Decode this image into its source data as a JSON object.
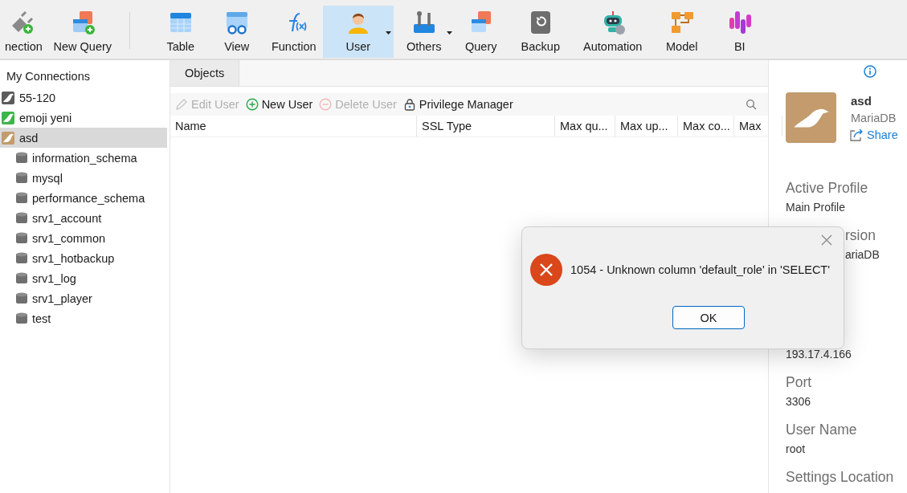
{
  "toolbar": {
    "items": [
      {
        "label": "nection",
        "selected": false,
        "dropdown": false
      },
      {
        "label": "New Query",
        "selected": false,
        "dropdown": false
      },
      {
        "label": "Table",
        "selected": false,
        "dropdown": false
      },
      {
        "label": "View",
        "selected": false,
        "dropdown": false
      },
      {
        "label": "Function",
        "selected": false,
        "dropdown": false
      },
      {
        "label": "User",
        "selected": true,
        "dropdown": true
      },
      {
        "label": "Others",
        "selected": false,
        "dropdown": true
      },
      {
        "label": "Query",
        "selected": false,
        "dropdown": false
      },
      {
        "label": "Backup",
        "selected": false,
        "dropdown": false
      },
      {
        "label": "Automation",
        "selected": false,
        "dropdown": false
      },
      {
        "label": "Model",
        "selected": false,
        "dropdown": false
      },
      {
        "label": "BI",
        "selected": false,
        "dropdown": false
      }
    ]
  },
  "sidebar": {
    "title": "My Connections",
    "connections": [
      {
        "name": "55-120",
        "selected": false,
        "color": "#5b5b5b"
      },
      {
        "name": "emoji yeni",
        "selected": false,
        "color": "#3db54a"
      },
      {
        "name": "asd",
        "selected": true,
        "color": "#c39b6c",
        "children": [
          {
            "name": "information_schema"
          },
          {
            "name": "mysql"
          },
          {
            "name": "performance_schema"
          },
          {
            "name": "srv1_account"
          },
          {
            "name": "srv1_common"
          },
          {
            "name": "srv1_hotbackup"
          },
          {
            "name": "srv1_log"
          },
          {
            "name": "srv1_player"
          },
          {
            "name": "test"
          }
        ]
      }
    ]
  },
  "tabs": [
    {
      "label": "Objects",
      "selected": true
    }
  ],
  "actions": [
    {
      "label": "Edit User",
      "disabled": true,
      "kind": "edit"
    },
    {
      "label": "New User",
      "disabled": false,
      "kind": "add"
    },
    {
      "label": "Delete User",
      "disabled": true,
      "kind": "remove"
    },
    {
      "label": "Privilege Manager",
      "disabled": false,
      "kind": "lock"
    }
  ],
  "table": {
    "columns": [
      "Name",
      "SSL Type",
      "Max qu...",
      "Max up...",
      "Max co...",
      "Max"
    ]
  },
  "info_panel": {
    "name": "asd",
    "type": "MariaDB",
    "share": "Share",
    "fields": [
      {
        "kind": "full",
        "label": "Active Profile",
        "value": "Main Profile"
      },
      {
        "kind": "partial",
        "label": "rsion",
        "value": "ariaDB"
      },
      {
        "kind": "value_only",
        "value": "193.17.4.166"
      },
      {
        "kind": "full",
        "label": "Port",
        "value": "3306"
      },
      {
        "kind": "full",
        "label": "User Name",
        "value": "root"
      },
      {
        "kind": "label_only",
        "label": "Settings Location"
      }
    ]
  },
  "dialog": {
    "message": "1054 - Unknown column 'default_role' in 'SELECT'",
    "button": "OK"
  }
}
